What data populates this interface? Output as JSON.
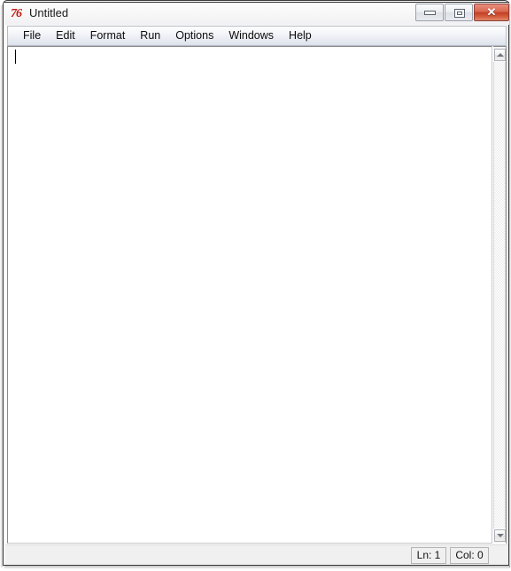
{
  "window": {
    "title": "Untitled",
    "app_icon": "python-idle-icon",
    "icon_glyph": "76",
    "controls": {
      "minimize_label": "–",
      "maximize_label": "□",
      "close_label": "✕"
    }
  },
  "menu": {
    "items": [
      {
        "label": "File"
      },
      {
        "label": "Edit"
      },
      {
        "label": "Format"
      },
      {
        "label": "Run"
      },
      {
        "label": "Options"
      },
      {
        "label": "Windows"
      },
      {
        "label": "Help"
      }
    ]
  },
  "editor": {
    "content": "",
    "placeholder": "",
    "caret_visible": true
  },
  "scrollbar": {
    "up_arrow": "scroll-up-arrow",
    "down_arrow": "scroll-down-arrow"
  },
  "status_bar": {
    "line_label": "Ln: 1",
    "column_label": "Col: 0"
  },
  "colors": {
    "close_button_red": "#c33f26",
    "icon_red": "#c3170f",
    "menu_bar_bg": "#e9edf4",
    "status_bar_bg": "#f0f0f0",
    "editor_bg": "#ffffff",
    "frame_border": "#3a3a3a"
  }
}
